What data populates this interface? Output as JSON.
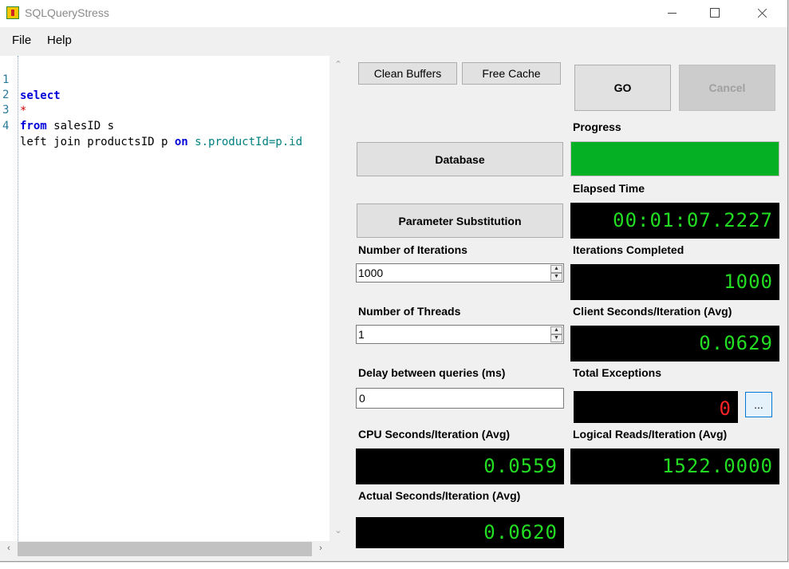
{
  "window": {
    "title": "SQLQueryStress"
  },
  "menu": {
    "file": "File",
    "help": "Help"
  },
  "editor": {
    "lines": [
      {
        "num": "1",
        "text": "select"
      },
      {
        "num": "2",
        "text": "*"
      },
      {
        "num": "3",
        "kw": "from",
        "text": " salesID s"
      },
      {
        "num": "4",
        "pre": "left join productsID p ",
        "kw": "on",
        "post": " s.productId=p.id"
      }
    ]
  },
  "buttons": {
    "clean_buffers": "Clean Buffers",
    "free_cache": "Free Cache",
    "go": "GO",
    "cancel": "Cancel",
    "database": "Database",
    "parameter_substitution": "Parameter Substitution",
    "exceptions_details": "..."
  },
  "labels": {
    "progress": "Progress",
    "elapsed_time": "Elapsed Time",
    "number_of_iterations": "Number of Iterations",
    "iterations_completed": "Iterations Completed",
    "number_of_threads": "Number of Threads",
    "client_seconds": "Client Seconds/Iteration (Avg)",
    "delay_between_queries": "Delay between queries (ms)",
    "total_exceptions": "Total Exceptions",
    "cpu_seconds": "CPU Seconds/Iteration (Avg)",
    "logical_reads": "Logical Reads/Iteration (Avg)",
    "actual_seconds": "Actual Seconds/Iteration (Avg)"
  },
  "inputs": {
    "number_of_iterations": "1000",
    "number_of_threads": "1",
    "delay_between_queries": "0"
  },
  "progress": {
    "fraction": 1.0,
    "color": "#06b025"
  },
  "displays": {
    "elapsed_time": "00:01:07.2227",
    "iterations_completed": "1000",
    "client_seconds": "0.0629",
    "total_exceptions": "0",
    "cpu_seconds": "0.0559",
    "logical_reads": "1522.0000",
    "actual_seconds": "0.0620"
  },
  "colors": {
    "lcd_text": "#22dd22",
    "exception_text": "#ff2222",
    "keyword": "#0000d8"
  }
}
